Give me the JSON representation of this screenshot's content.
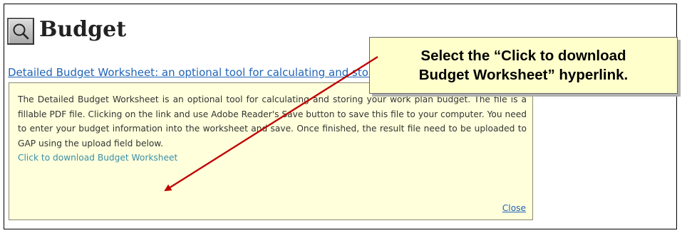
{
  "header": {
    "title": "Budget",
    "icon": "magnifier-icon"
  },
  "worksheet_link": {
    "label": "Detailed Budget Worksheet: an optional tool for calculating and storing your work plan budget"
  },
  "tooltip": {
    "body": "The Detailed Budget Worksheet is an optional tool for calculating and storing your work plan budget. The file is a fillable PDF file. Clicking on the link and use Adobe Reader's Save button to save this file to your computer. You need to enter your budget information into the worksheet and save. Once finished, the result file need to be uploaded to GAP using the upload field below.",
    "download_label": "Click to download Budget Worksheet",
    "close_label": "Close"
  },
  "callout": {
    "line1": "Select the “Click to download",
    "line2": "Budget Worksheet” hyperlink."
  },
  "colors": {
    "link": "#1f64b6",
    "tooltip_bg": "#ffffdc",
    "callout_bg": "#ffffcc",
    "arrow": "#c00000"
  }
}
